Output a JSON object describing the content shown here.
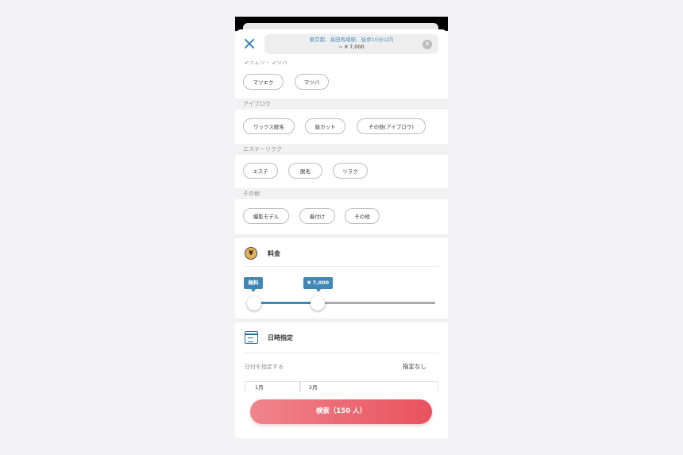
{
  "header": {
    "search_line1": "東京都、高田馬場駅、徒歩10分以内",
    "search_line2": "~ ¥ 7,000",
    "clear_glyph": "✕"
  },
  "categories": {
    "cut_label": "マツエク・マツパ",
    "group1": {
      "chips": [
        "マツエク",
        "マツパ"
      ]
    },
    "group2": {
      "label": "アイブロウ",
      "chips": [
        "ワックス脱毛",
        "眉カット",
        "その他(アイブロウ)"
      ]
    },
    "group3": {
      "label": "エステ・リラク",
      "chips": [
        "エステ",
        "脱毛",
        "リラク"
      ]
    },
    "group4": {
      "label": "その他",
      "chips": [
        "撮影モデル",
        "着付け",
        "その他"
      ]
    }
  },
  "price": {
    "title": "料金",
    "icon": "yen-coin-icon",
    "icon_glyph": "¥",
    "min_label": "無料",
    "max_label": "¥ 7,000",
    "range_fraction": [
      0.0,
      0.35
    ]
  },
  "date": {
    "title": "日時指定",
    "icon": "calendar-icon",
    "prompt": "日付を指定する",
    "value": "指定なし",
    "months": [
      "1月",
      "2月"
    ]
  },
  "footer": {
    "search_label": "検索（150 人）"
  },
  "colors": {
    "accent": "#3f87b5",
    "button_start": "#f0848d",
    "button_end": "#e8525d"
  }
}
